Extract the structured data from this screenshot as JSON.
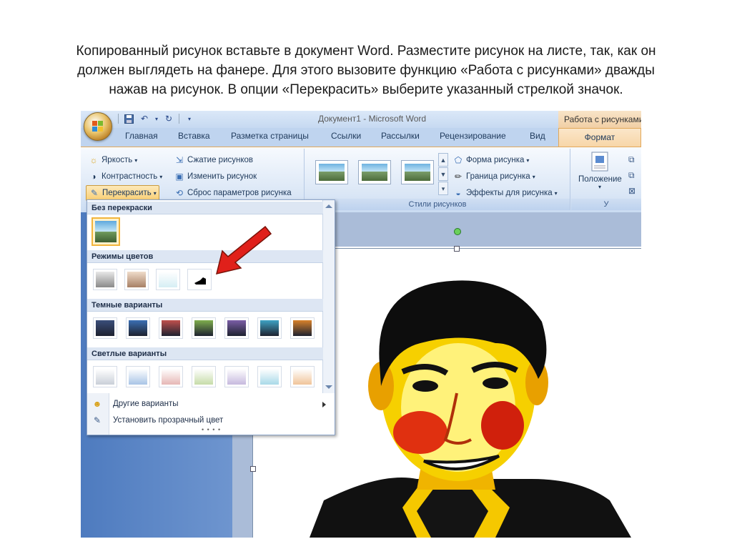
{
  "instruction": {
    "line1": "Копированный рисунок вставьте в документ  Word. Разместите рисунок на листе, так, как он",
    "line2": "должен выглядеть на  фанере.  Для этого вызовите функцию «Работа с рисунками» дважды",
    "line3": "нажав на рисунок. В опции «Перекрасить» выберите указанный стрелкой значок."
  },
  "window": {
    "title": "Документ1 - Microsoft Word",
    "context_tab_title": "Работа с рисунками",
    "qat_icons": [
      "save-icon",
      "undo-icon",
      "redo-icon",
      "customize-icon"
    ]
  },
  "tabs": [
    "Главная",
    "Вставка",
    "Разметка страницы",
    "Ссылки",
    "Рассылки",
    "Рецензирование",
    "Вид"
  ],
  "active_tab": "Формат",
  "ribbon": {
    "adjust": {
      "brightness": "Яркость",
      "contrast": "Контрастность",
      "recolor": "Перекрасить",
      "compress": "Сжатие рисунков",
      "change": "Изменить рисунок",
      "reset": "Сброс параметров рисунка"
    },
    "styles": {
      "label": "Стили рисунков",
      "shape": "Форма рисунка",
      "border": "Граница рисунка",
      "effects": "Эффекты для рисунка"
    },
    "arrange": {
      "position": "Положение",
      "label_partial": "У"
    }
  },
  "recolor_menu": {
    "sections": {
      "no_recolor": "Без перекраски",
      "color_modes": "Режимы цветов",
      "dark": "Темные варианты",
      "light": "Светлые варианты"
    },
    "dark_variants": [
      "#3a4e7a",
      "#3b6fb4",
      "#c0504d",
      "#7fae4e",
      "#7b5ea7",
      "#3fa3c4",
      "#d9822b"
    ],
    "light_variants": [
      "#c9cfd8",
      "#a8c4e6",
      "#e6b7b5",
      "#c6dca9",
      "#c6b9de",
      "#a9d9e8",
      "#f0c49a"
    ],
    "more_variants": "Другие варианты",
    "set_transparent": "Установить прозрачный цвет"
  },
  "colors": {
    "accent": "#f7d6a8",
    "ribbon": "#dbe7f6",
    "arrow": "#e0201a"
  }
}
